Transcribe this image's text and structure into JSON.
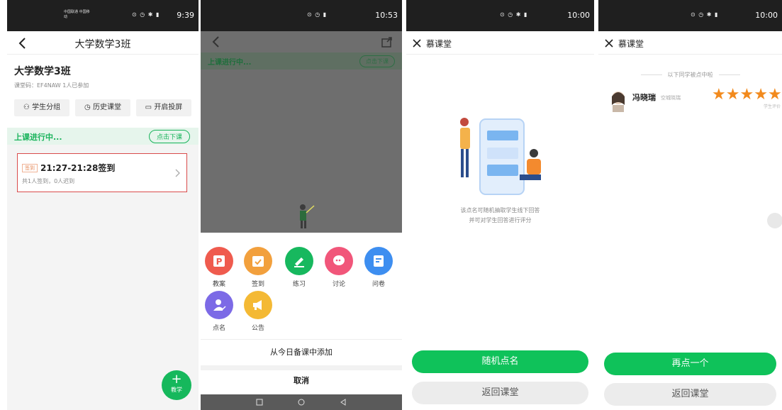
{
  "p1": {
    "status": {
      "carrier": "中国联通 中国移动",
      "icons": "⊙ ◷ ✱ ▮",
      "battery": "98",
      "time": "9:39"
    },
    "title": "大学数学3班",
    "class_name": "大学数学3班",
    "class_meta": "课堂码：EF4NAW   1人已参加",
    "actions": [
      "学生分组",
      "历史课堂",
      "开启投屏"
    ],
    "ongoing": "上课进行中...",
    "end_btn": "点击下课",
    "card_tag": "签到",
    "card_title": "21:27-21:28签到",
    "card_sub": "共1人签到，0人迟到",
    "fab_plus": "+",
    "fab_label": "教学"
  },
  "p2": {
    "status": {
      "battery": "75",
      "time": "10:53"
    },
    "ongoing": "上课进行中...",
    "end_btn": "点击下课",
    "tools": [
      {
        "label": "教案",
        "color": "#ef5b4e"
      },
      {
        "label": "签到",
        "color": "#f2a03d"
      },
      {
        "label": "练习",
        "color": "#17b85e"
      },
      {
        "label": "讨论",
        "color": "#f1567a"
      },
      {
        "label": "问卷",
        "color": "#3d8ef0"
      },
      {
        "label": "点名",
        "color": "#7c6ae6"
      },
      {
        "label": "公告",
        "color": "#f4b934"
      }
    ],
    "add_from": "从今日备课中添加",
    "cancel": "取消"
  },
  "p3": {
    "status": {
      "battery": "98",
      "time": "10:00"
    },
    "title": "慕课堂",
    "desc_line1": "该点名可随机抽取学生线下回答",
    "desc_line2": "并可对学生回答进行评分",
    "random_btn": "随机点名",
    "back_btn": "返回课堂"
  },
  "p4": {
    "status": {
      "battery": "98",
      "time": "10:00"
    },
    "title": "慕课堂",
    "called_title": "以下同学被点中啦",
    "student_name": "冯晓瑞",
    "student_sub": "空城晓瑞",
    "rating": 5,
    "rating_label": "学生评价",
    "again_btn": "再点一个",
    "back_btn": "返回课堂"
  }
}
